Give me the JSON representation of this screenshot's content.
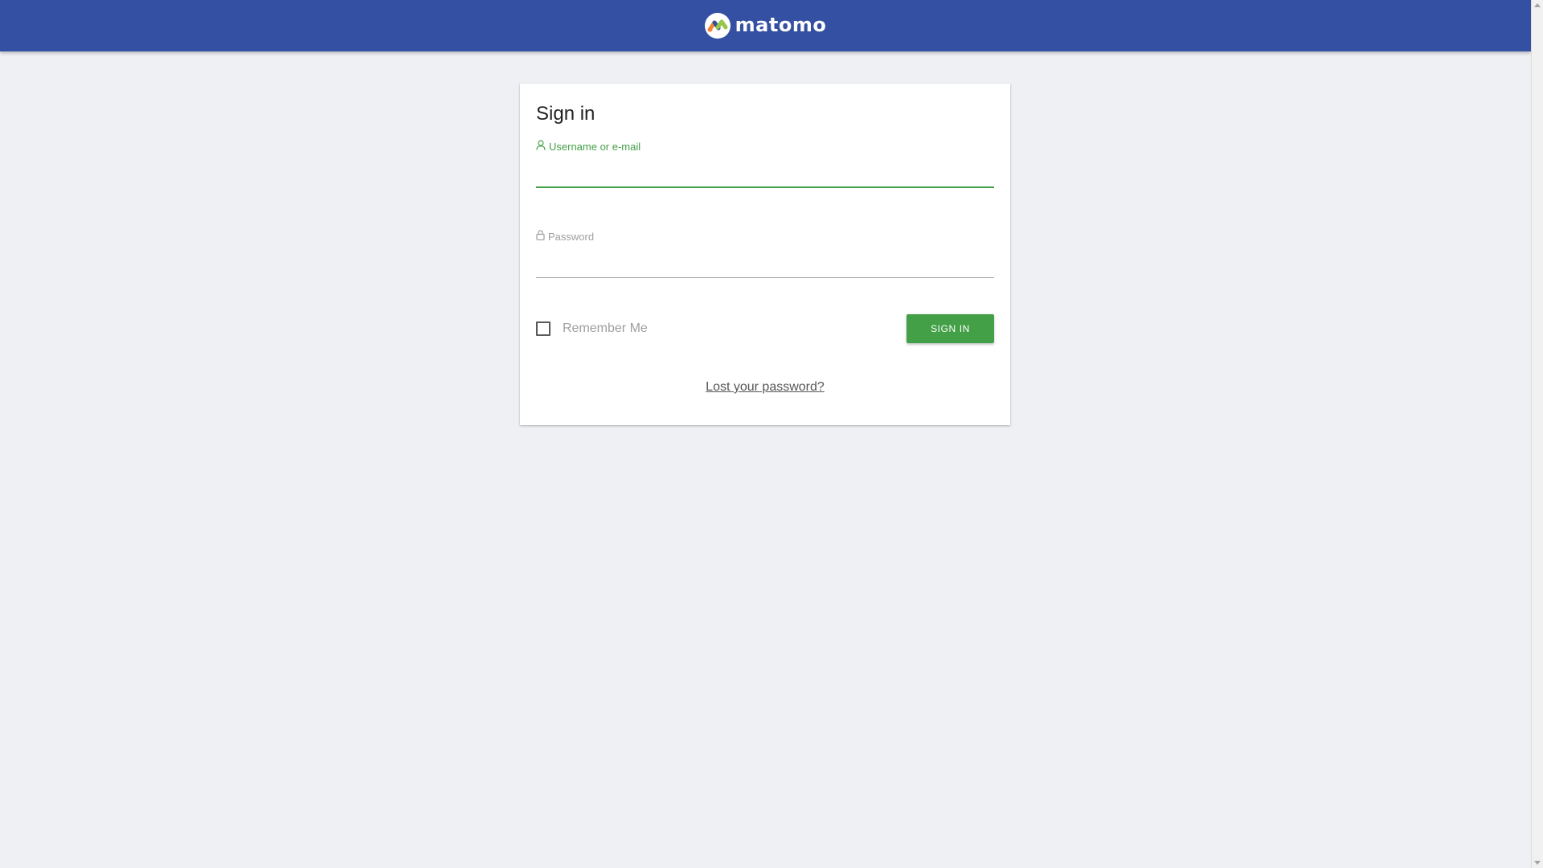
{
  "header": {
    "logo_text": "matomo",
    "background_color": "#3450a3"
  },
  "login": {
    "title": "Sign in",
    "username": {
      "icon": "user-icon",
      "label": "Username or e-mail",
      "value": ""
    },
    "password": {
      "icon": "lock-icon",
      "label": "Password",
      "value": ""
    },
    "remember_me": {
      "label": "Remember Me",
      "checked": false
    },
    "submit_label": "SIGN IN",
    "lost_password_label": "Lost your password?"
  },
  "colors": {
    "accent": "#43a047",
    "page_background": "#eef0f3"
  }
}
